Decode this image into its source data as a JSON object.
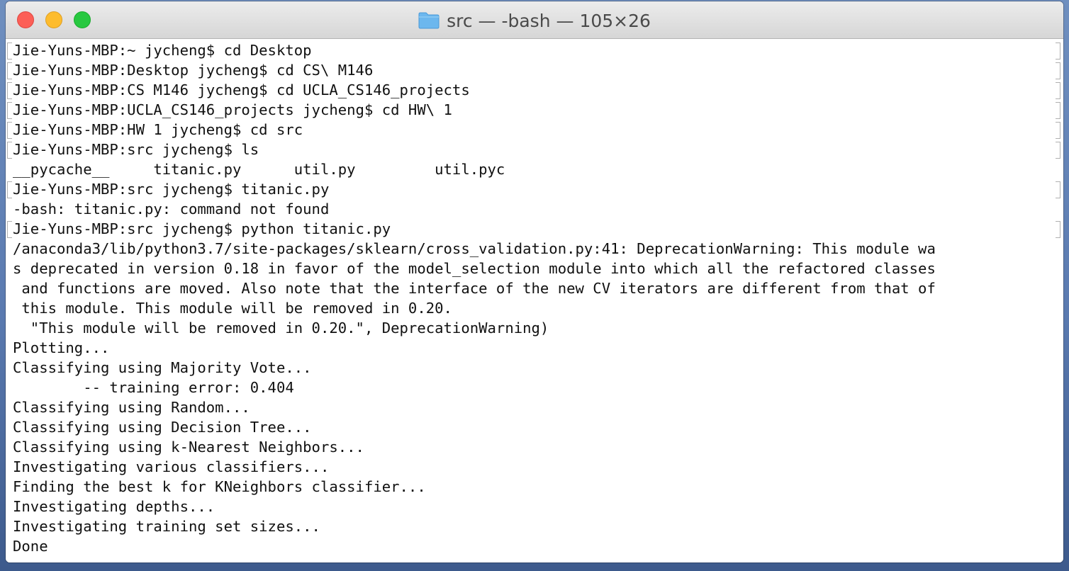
{
  "window": {
    "title": "src — -bash — 105×26"
  },
  "icons": {
    "title_icon": "folder-icon"
  },
  "colors": {
    "close": "#fc5f57",
    "minimize": "#fdbc2e",
    "maximize": "#28c840",
    "folder": "#6cb7ee"
  },
  "terminal": {
    "lines": [
      "Jie-Yuns-MBP:~ jycheng$ cd Desktop",
      "Jie-Yuns-MBP:Desktop jycheng$ cd CS\\ M146",
      "Jie-Yuns-MBP:CS M146 jycheng$ cd UCLA_CS146_projects",
      "Jie-Yuns-MBP:UCLA_CS146_projects jycheng$ cd HW\\ 1",
      "Jie-Yuns-MBP:HW 1 jycheng$ cd src",
      "Jie-Yuns-MBP:src jycheng$ ls",
      "__pycache__     titanic.py      util.py         util.pyc",
      "Jie-Yuns-MBP:src jycheng$ titanic.py",
      "-bash: titanic.py: command not found",
      "Jie-Yuns-MBP:src jycheng$ python titanic.py",
      "/anaconda3/lib/python3.7/site-packages/sklearn/cross_validation.py:41: DeprecationWarning: This module wa",
      "s deprecated in version 0.18 in favor of the model_selection module into which all the refactored classes",
      " and functions are moved. Also note that the interface of the new CV iterators are different from that of",
      " this module. This module will be removed in 0.20.",
      "  \"This module will be removed in 0.20.\", DeprecationWarning)",
      "Plotting...",
      "Classifying using Majority Vote...",
      "        -- training error: 0.404",
      "Classifying using Random...",
      "Classifying using Decision Tree...",
      "Classifying using k-Nearest Neighbors...",
      "Investigating various classifiers...",
      "Finding the best k for KNeighbors classifier...",
      "Investigating depths...",
      "Investigating training set sizes...",
      "Done"
    ]
  }
}
